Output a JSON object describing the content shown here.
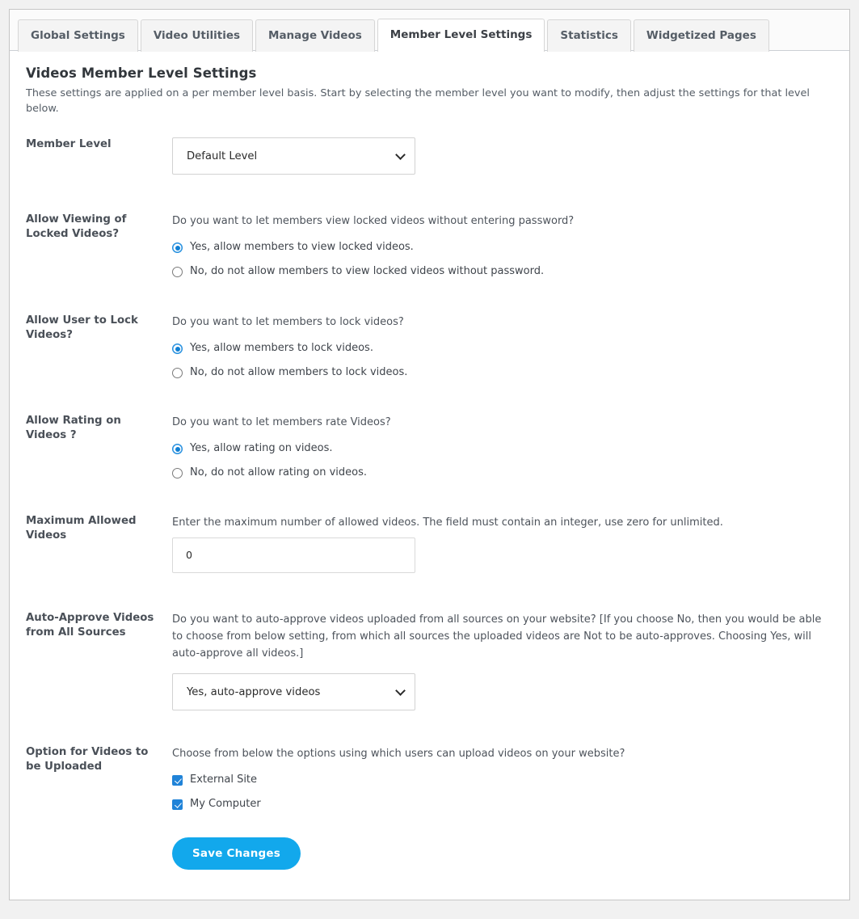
{
  "tabs": [
    {
      "label": "Global Settings",
      "active": false
    },
    {
      "label": "Video Utilities",
      "active": false
    },
    {
      "label": "Manage Videos",
      "active": false
    },
    {
      "label": "Member Level Settings",
      "active": true
    },
    {
      "label": "Statistics",
      "active": false
    },
    {
      "label": "Widgetized Pages",
      "active": false
    }
  ],
  "page": {
    "title": "Videos Member Level Settings",
    "description": "These settings are applied on a per member level basis. Start by selecting the member level you want to modify, then adjust the settings for that level below."
  },
  "member_level": {
    "label": "Member Level",
    "selected": "Default Level"
  },
  "allow_viewing_locked": {
    "label": "Allow Viewing of Locked Videos?",
    "help": "Do you want to let members view locked videos without entering password?",
    "options": [
      {
        "label": "Yes, allow members to view locked videos.",
        "checked": true
      },
      {
        "label": "No, do not allow members to view locked videos without password.",
        "checked": false
      }
    ]
  },
  "allow_lock": {
    "label": "Allow User to Lock Videos?",
    "help": "Do you want to let members to lock videos?",
    "options": [
      {
        "label": "Yes, allow members to lock videos.",
        "checked": true
      },
      {
        "label": "No, do not allow members to lock videos.",
        "checked": false
      }
    ]
  },
  "allow_rating": {
    "label": "Allow Rating on Videos ?",
    "help": "Do you want to let members rate Videos?",
    "options": [
      {
        "label": "Yes, allow rating on videos.",
        "checked": true
      },
      {
        "label": "No, do not allow rating on videos.",
        "checked": false
      }
    ]
  },
  "maximum_allowed": {
    "label": "Maximum Allowed Videos",
    "help": "Enter the maximum number of allowed videos. The field must contain an integer, use zero for unlimited.",
    "value": "0"
  },
  "auto_approve": {
    "label": "Auto-Approve Videos from All Sources",
    "help": "Do you want to auto-approve videos uploaded from all sources on your website? [If you choose No, then you would be able to choose from below setting, from which all sources the uploaded videos are Not to be auto-approves. Choosing Yes, will auto-approve all videos.]",
    "selected": "Yes, auto-approve videos"
  },
  "upload_options": {
    "label": "Option for Videos to be Uploaded",
    "help": "Choose from below the options using which users can upload videos on your website?",
    "options": [
      {
        "label": "External Site",
        "checked": true
      },
      {
        "label": "My Computer",
        "checked": true
      }
    ]
  },
  "save": {
    "label": "Save Changes"
  },
  "colors": {
    "accent": "#12a8ec",
    "radio_checked": "#0f7fd4",
    "checkbox_checked": "#2083d8",
    "page_background": "#f1f1f1",
    "panel_background": "#ffffff",
    "border": "#c6c6c6"
  }
}
